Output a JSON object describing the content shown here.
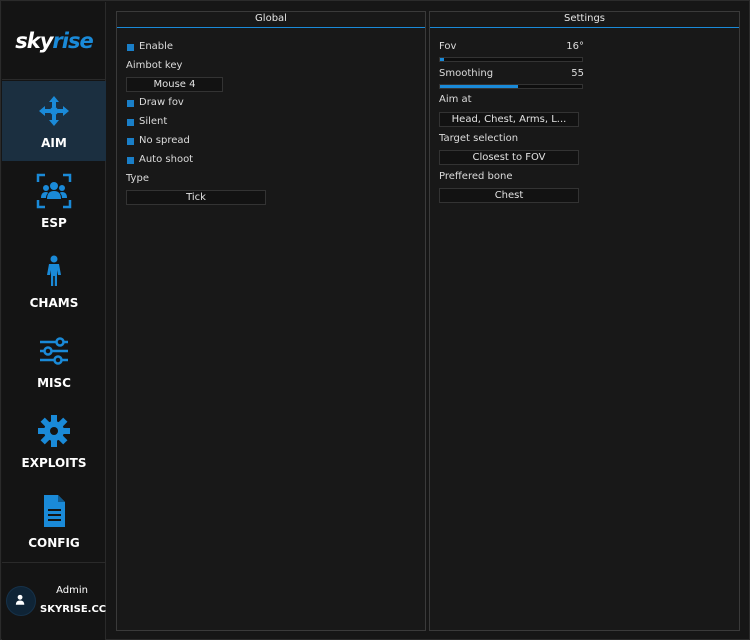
{
  "brand": {
    "logo_part1": "sky",
    "logo_part2": "rise"
  },
  "sidebar": {
    "items": [
      {
        "label": "AIM",
        "icon": "crosshair-arrows-icon",
        "active": true
      },
      {
        "label": "ESP",
        "icon": "users-frame-icon",
        "active": false
      },
      {
        "label": "CHAMS",
        "icon": "person-icon",
        "active": false
      },
      {
        "label": "MISC",
        "icon": "sliders-icon",
        "active": false
      },
      {
        "label": "EXPLOITS",
        "icon": "gear-icon",
        "active": false
      },
      {
        "label": "CONFIG",
        "icon": "document-icon",
        "active": false
      }
    ]
  },
  "user": {
    "name": "Admin",
    "site": "SKYRISE.CC"
  },
  "global_panel": {
    "title": "Global",
    "enable_label": "Enable",
    "enable_checked": true,
    "aimbot_key_label": "Aimbot key",
    "aimbot_key_value": "Mouse 4",
    "draw_fov_label": "Draw fov",
    "draw_fov_checked": true,
    "silent_label": "Silent",
    "silent_checked": true,
    "no_spread_label": "No spread",
    "no_spread_checked": true,
    "auto_shoot_label": "Auto shoot",
    "auto_shoot_checked": true,
    "type_label": "Type",
    "type_value": "Tick"
  },
  "settings_panel": {
    "title": "Settings",
    "fov_label": "Fov",
    "fov_value": "16°",
    "fov_fraction": 0.03,
    "smoothing_label": "Smoothing",
    "smoothing_value": "55",
    "smoothing_fraction": 0.55,
    "aim_at_label": "Aim at",
    "aim_at_value": "Head, Chest, Arms, L...",
    "target_selection_label": "Target selection",
    "target_selection_value": "Closest to FOV",
    "preferred_bone_label": "Preffered bone",
    "preferred_bone_value": "Chest"
  },
  "colors": {
    "accent": "#1a8ad8",
    "active_nav_bg": "#1b2f40",
    "background": "#161616"
  }
}
